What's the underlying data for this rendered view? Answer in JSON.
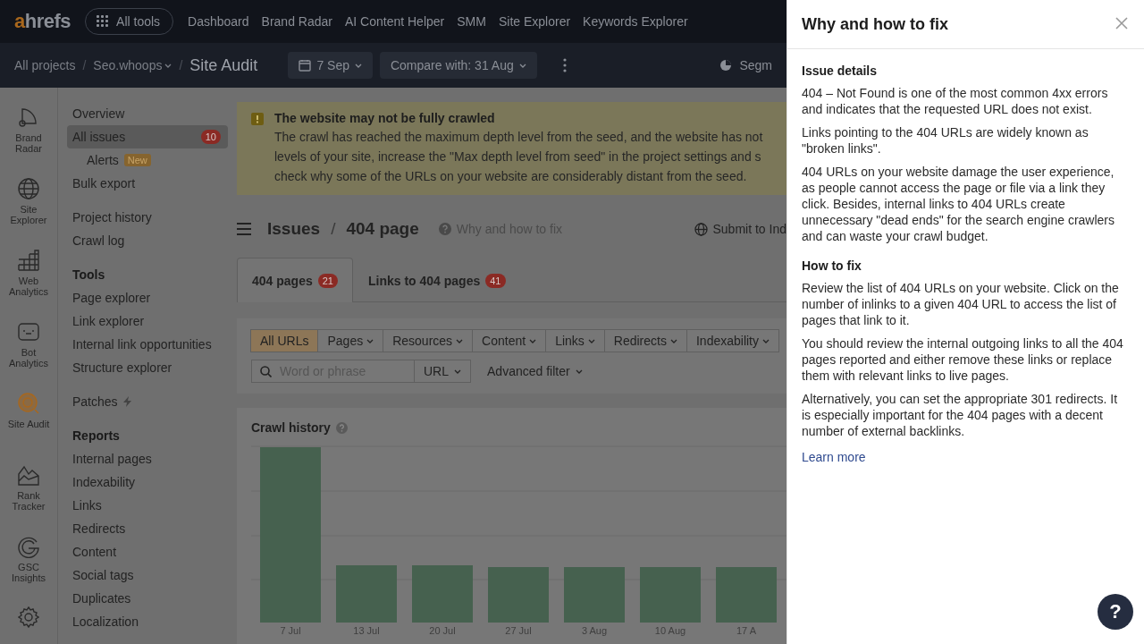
{
  "header": {
    "logo": "ahrefs",
    "all_tools": "All tools",
    "nav": [
      "Dashboard",
      "Brand Radar",
      "AI Content Helper",
      "SMM",
      "Site Explorer",
      "Keywords Explorer"
    ]
  },
  "breadcrumb": {
    "items": [
      "All projects",
      "Seo.whoops",
      "Site Audit"
    ],
    "separator": "/",
    "date": "7 Sep",
    "compare": "Compare with: 31 Aug",
    "segments": "Segm"
  },
  "rail": [
    {
      "label": "Brand Radar",
      "selected": false
    },
    {
      "label": "Site Explorer",
      "selected": false
    },
    {
      "label": "Web Analytics",
      "selected": false
    },
    {
      "label": "Bot Analytics",
      "selected": false
    },
    {
      "label": "Site Audit",
      "selected": true
    },
    {
      "label": "Rank Tracker",
      "selected": false
    },
    {
      "label": "GSC Insights",
      "selected": false
    }
  ],
  "sidebar": {
    "groups": [
      {
        "items": [
          {
            "label": "Overview",
            "selected": false
          },
          {
            "label": "All issues",
            "selected": true,
            "badge": "10",
            "children": [
              {
                "label": "Alerts",
                "selected": false,
                "tag": "New"
              }
            ]
          },
          {
            "label": "Bulk export",
            "selected": false
          }
        ]
      },
      {
        "items": [
          {
            "label": "Project history",
            "selected": false
          },
          {
            "label": "Crawl log",
            "selected": false
          }
        ]
      },
      {
        "heading": "Tools",
        "items": [
          {
            "label": "Page explorer",
            "selected": false
          },
          {
            "label": "Link explorer",
            "selected": false
          },
          {
            "label": "Internal link opportunities",
            "selected": false
          },
          {
            "label": "Structure explorer",
            "selected": false
          }
        ]
      },
      {
        "items": [
          {
            "label": "Patches",
            "selected": false,
            "bolt": true
          }
        ]
      },
      {
        "heading": "Reports",
        "items": [
          {
            "label": "Internal pages",
            "selected": false
          },
          {
            "label": "Indexability",
            "selected": false
          },
          {
            "label": "Links",
            "selected": false
          },
          {
            "label": "Redirects",
            "selected": false
          },
          {
            "label": "Content",
            "selected": false
          },
          {
            "label": "Social tags",
            "selected": false
          },
          {
            "label": "Duplicates",
            "selected": false
          },
          {
            "label": "Localization",
            "selected": false
          }
        ]
      }
    ]
  },
  "banner": {
    "title": "The website may not be fully crawled",
    "lines": [
      "The crawl has reached the maximum depth level from the seed, and the website has not",
      "levels of your site, increase the \"Max depth level from seed\" in the project settings and s",
      "check why some of the URLs on your website are considerably distant from the seed."
    ]
  },
  "page": {
    "crumbs": [
      "Issues",
      "404 page"
    ],
    "separator": "/",
    "help_link": "Why and how to fix",
    "submit": "Submit to Ind"
  },
  "tabs": [
    {
      "label": "404 pages",
      "count": "21",
      "selected": true
    },
    {
      "label": "Links to 404 pages",
      "count": "41",
      "selected": false
    }
  ],
  "filters": [
    {
      "label": "All URLs",
      "selected": true,
      "dropdown": false
    },
    {
      "label": "Pages",
      "selected": false,
      "dropdown": true
    },
    {
      "label": "Resources",
      "selected": false,
      "dropdown": true
    },
    {
      "label": "Content",
      "selected": false,
      "dropdown": true
    },
    {
      "label": "Links",
      "selected": false,
      "dropdown": true
    },
    {
      "label": "Redirects",
      "selected": false,
      "dropdown": true
    },
    {
      "label": "Indexability",
      "selected": false,
      "dropdown": true
    }
  ],
  "search": {
    "placeholder": "Word or phrase",
    "scope": "URL",
    "advanced": "Advanced filter"
  },
  "crawl_history": {
    "title": "Crawl history",
    "x_labels": [
      "7 Jul",
      "13 Jul",
      "20 Jul",
      "27 Jul",
      "3 Aug",
      "10 Aug",
      "17 A"
    ]
  },
  "drawer": {
    "title": "Why and how to fix",
    "sections": [
      {
        "heading": "Issue details",
        "paragraphs": [
          "404 – Not Found is one of the most common 4xx errors and indicates that the requested URL does not exist.",
          "Links pointing to the 404 URLs are widely known as \"broken links\".",
          "404 URLs on your website damage the user experience, as people cannot access the page or file via a link they click. Besides, internal links to 404 URLs create unnecessary \"dead ends\" for the search engine crawlers and can waste your crawl budget."
        ]
      },
      {
        "heading": "How to fix",
        "paragraphs": [
          "Review the list of 404 URLs on your website. Click on the number of inlinks to a given 404 URL to access the list of pages that link to it.",
          "You should review the internal outgoing links to all the 404 pages reported and either remove these links or replace them with relevant links to live pages.",
          "Alternatively, you can set the appropriate 301 redirects. It is especially important for the 404 pages with a decent number of external backlinks."
        ]
      }
    ],
    "link": "Learn more",
    "help": "?"
  }
}
